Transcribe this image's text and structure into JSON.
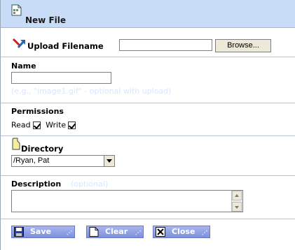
{
  "title": "New File",
  "upload": {
    "label": "Upload Filename",
    "file_value": "",
    "browse_label": "Browse..."
  },
  "name": {
    "label": "Name",
    "value": "",
    "hint": "(e.g., \"image1.gif\" - optional with upload)"
  },
  "permissions": {
    "label": "Permissions",
    "read_label": "Read",
    "read_checked": true,
    "write_label": "Write",
    "write_checked": true
  },
  "directory": {
    "label": "Directory",
    "selected": "/Ryan, Pat"
  },
  "description": {
    "label": "Description",
    "hint": "(optional)",
    "value": ""
  },
  "buttons": {
    "save": "Save",
    "clear": "Clear",
    "close": "Close"
  },
  "icons": {
    "title": "file-icon",
    "upload": "upload-arrow-icon",
    "directory": "folder-tag-icon",
    "save": "floppy-disk-icon",
    "clear": "blank-page-icon",
    "close": "close-x-icon"
  },
  "colors": {
    "title_bar": "#c9dcf7",
    "button": "#8c9be2",
    "hint_text": "#d7e6ff"
  }
}
